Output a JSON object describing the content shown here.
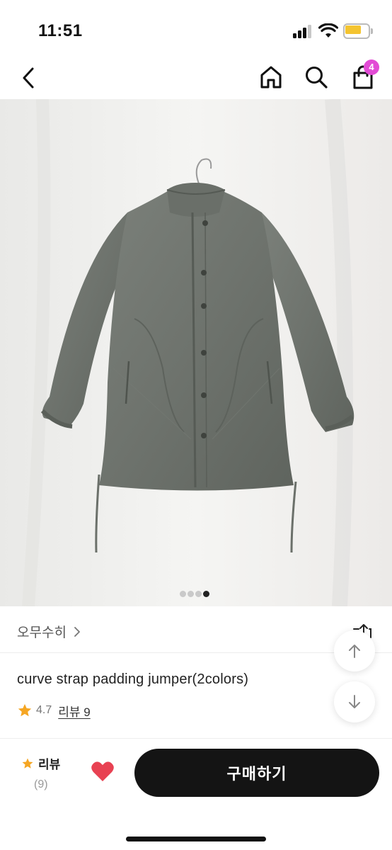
{
  "status_bar": {
    "time": "11:51",
    "signal_bars_active": 3,
    "battery_level": 0.7,
    "battery_color": "#f4c430"
  },
  "nav": {
    "back_icon": "chevron-left-icon",
    "home_icon": "home-icon",
    "search_icon": "search-icon",
    "cart_icon": "shopping-bag-icon",
    "cart_badge": "4",
    "badge_color": "#e24bd5"
  },
  "gallery": {
    "image": "olive gray quilted padded jumper on hanger",
    "page_count": 4,
    "active_page": 4
  },
  "product": {
    "brand": "오무수히",
    "title": "curve strap padding jumper(2colors)",
    "rating": "4.7",
    "reviews_link": "리뷰 9",
    "star_color": "#f5a623"
  },
  "floating": {
    "scroll_up_icon": "arrow-up-icon",
    "scroll_down_icon": "arrow-down-icon",
    "share_icon": "share-icon"
  },
  "bottom_bar": {
    "review_label": "리뷰",
    "review_count": "(9)",
    "like_icon": "heart-icon",
    "like_color": "#e84152",
    "buy_label": "구매하기",
    "buy_color": "#141414"
  }
}
